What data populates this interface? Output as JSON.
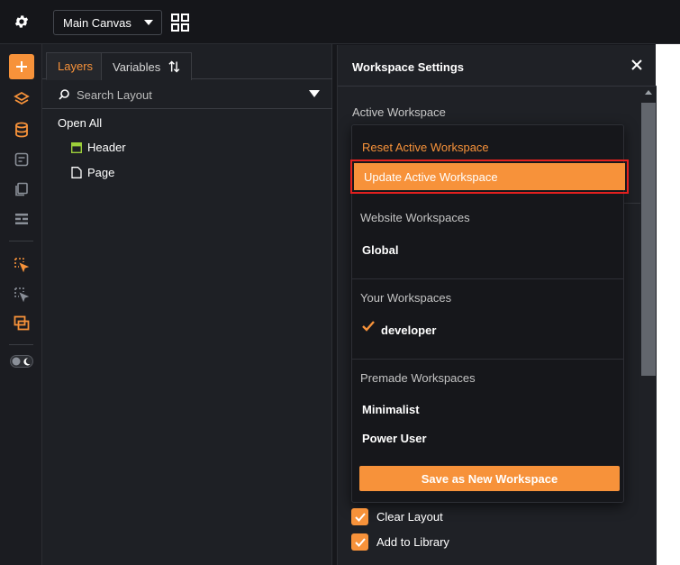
{
  "topbar": {
    "canvas_select": "Main Canvas",
    "icons": [
      "gear-icon",
      "grid-icon",
      "chevron-down-icon"
    ]
  },
  "rail": {
    "icons": [
      "plus-icon",
      "layers-icon",
      "database-icon",
      "component-icon",
      "pages-icon",
      "sections-icon",
      "select-tool-icon",
      "multi-select-icon",
      "windows-icon",
      "theme-toggle-icon"
    ],
    "accent": "#f7923a"
  },
  "layers_panel": {
    "tabs": [
      {
        "label": "Layers",
        "active": true
      },
      {
        "label": "Variables",
        "active": false
      }
    ],
    "search_placeholder": "Search Layout",
    "open_all": "Open All",
    "tree": [
      {
        "label": "Header",
        "icon": "header-icon"
      },
      {
        "label": "Page",
        "icon": "page-icon"
      }
    ]
  },
  "workspace": {
    "title": "Workspace Settings",
    "active_label": "Active Workspace",
    "dropdown": {
      "reset": "Reset Active Workspace",
      "update": "Update Active Workspace",
      "website_section": "Website Workspaces",
      "website_items": [
        "Global"
      ],
      "your_section": "Your Workspaces",
      "your_items": [
        {
          "label": "developer",
          "checked": true
        }
      ],
      "premade_section": "Premade Workspaces",
      "premade_items": [
        "Minimalist",
        "Power User"
      ],
      "save_button": "Save as New Workspace"
    },
    "options": [
      {
        "label": "Clear Layout",
        "checked": true
      },
      {
        "label": "Add to Library",
        "checked": true
      }
    ]
  },
  "colors": {
    "accent": "#f7923a",
    "highlight_border": "#e3201f",
    "panel_bg": "#1e2025"
  }
}
